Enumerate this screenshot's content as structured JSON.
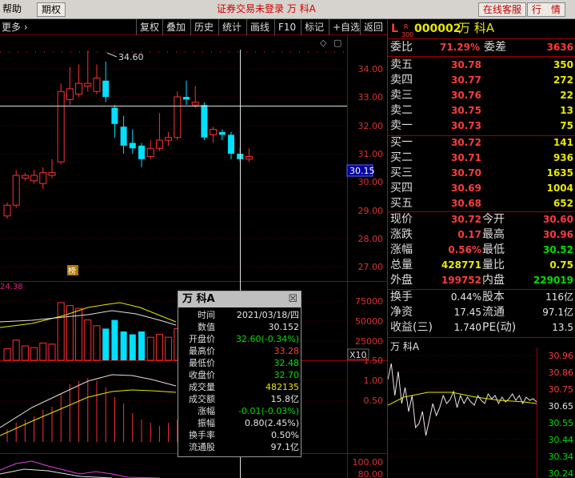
{
  "topbar": {
    "help": "帮助",
    "futures": "期权",
    "title": "证券交易未登录  万 科A",
    "service_btn": "在线客服",
    "quote_btn": "行　情"
  },
  "toolbar": {
    "more": "更多 ›",
    "items": [
      "复权",
      "叠加",
      "历史",
      "统计",
      "画线",
      "F10",
      "标记",
      "+自选",
      "返回"
    ]
  },
  "chart": {
    "price_axis": [
      "34.00",
      "33.00",
      "32.00",
      "31.00",
      "30.00",
      "29.00",
      "28.00",
      "27.00"
    ],
    "current_price_tag": "30.15",
    "high_marker": "34.60",
    "list_marker": "榜",
    "volume_label": "24.38",
    "volume_axis": [
      "75000",
      "50000",
      "25000"
    ],
    "volume_unit": "X10",
    "macd_axis": [
      "1.50",
      "1.00",
      "0.50"
    ],
    "kdj_axis": [
      "100.00",
      "80.00"
    ]
  },
  "chart_data": {
    "type": "candlestick",
    "ylim": [
      26.6,
      35.0
    ],
    "candles": [
      {
        "o": 28.5,
        "c": 28.9,
        "h": 29.0,
        "l": 28.4
      },
      {
        "o": 28.9,
        "c": 30.0,
        "h": 30.2,
        "l": 28.8
      },
      {
        "o": 29.9,
        "c": 30.0,
        "h": 30.1,
        "l": 29.8
      },
      {
        "o": 29.8,
        "c": 30.0,
        "h": 30.2,
        "l": 29.7
      },
      {
        "o": 29.7,
        "c": 30.1,
        "h": 30.3,
        "l": 29.5
      },
      {
        "o": 30.0,
        "c": 30.1,
        "h": 30.6,
        "l": 29.9
      },
      {
        "o": 30.5,
        "c": 33.1,
        "h": 33.4,
        "l": 30.4
      },
      {
        "o": 32.8,
        "c": 33.2,
        "h": 34.0,
        "l": 32.6
      },
      {
        "o": 33.0,
        "c": 33.4,
        "h": 34.1,
        "l": 32.9
      },
      {
        "o": 33.3,
        "c": 33.4,
        "h": 34.6,
        "l": 33.1
      },
      {
        "o": 33.1,
        "c": 33.6,
        "h": 34.1,
        "l": 33.0
      },
      {
        "o": 33.5,
        "c": 32.9,
        "h": 34.2,
        "l": 32.7
      },
      {
        "o": 32.5,
        "c": 31.9,
        "h": 32.6,
        "l": 31.4
      },
      {
        "o": 31.8,
        "c": 31.1,
        "h": 32.2,
        "l": 30.8
      },
      {
        "o": 31.2,
        "c": 31.0,
        "h": 31.7,
        "l": 30.8
      },
      {
        "o": 31.1,
        "c": 30.6,
        "h": 31.2,
        "l": 30.3
      },
      {
        "o": 30.7,
        "c": 31.0,
        "h": 31.3,
        "l": 30.6
      },
      {
        "o": 31.0,
        "c": 31.3,
        "h": 32.3,
        "l": 30.9
      },
      {
        "o": 31.3,
        "c": 31.4,
        "h": 31.6,
        "l": 31.1
      },
      {
        "o": 31.4,
        "c": 32.9,
        "h": 33.1,
        "l": 31.3
      },
      {
        "o": 32.9,
        "c": 32.8,
        "h": 33.5,
        "l": 32.6
      },
      {
        "o": 32.6,
        "c": 32.7,
        "h": 33.3,
        "l": 32.5
      },
      {
        "o": 32.6,
        "c": 31.4,
        "h": 32.7,
        "l": 31.3
      },
      {
        "o": 31.5,
        "c": 31.7,
        "h": 31.8,
        "l": 31.2
      },
      {
        "o": 31.6,
        "c": 31.5,
        "h": 31.7,
        "l": 31.3
      },
      {
        "o": 31.5,
        "c": 30.8,
        "h": 31.6,
        "l": 30.6
      },
      {
        "o": 30.8,
        "c": 30.6,
        "h": 31.0,
        "l": 30.5
      },
      {
        "o": 30.6,
        "c": 30.7,
        "h": 31.0,
        "l": 30.5
      }
    ]
  },
  "tooltip": {
    "name": "万 科A",
    "rows": [
      {
        "label": "时间",
        "value": "2021/03/18/四",
        "color": "#e6e6e6"
      },
      {
        "label": "数值",
        "value": "30.152",
        "color": "#e6e6e6"
      },
      {
        "label": "开盘价",
        "value": "32.60(-0.34%)",
        "color": "#00e000"
      },
      {
        "label": "最高价",
        "value": "33.28",
        "color": "#ff3b3b"
      },
      {
        "label": "最低价",
        "value": "32.48",
        "color": "#00e000"
      },
      {
        "label": "收盘价",
        "value": "32.70",
        "color": "#00e000"
      },
      {
        "label": "成交量",
        "value": "482135",
        "color": "#e8e800"
      },
      {
        "label": "成交额",
        "value": "15.8亿",
        "color": "#e6e6e6"
      },
      {
        "label": "涨幅",
        "value": "-0.01(-0.03%)",
        "color": "#00e000"
      },
      {
        "label": "振幅",
        "value": "0.80(2.45%)",
        "color": "#e6e6e6"
      },
      {
        "label": "换手率",
        "value": "0.50%",
        "color": "#e6e6e6"
      },
      {
        "label": "流通股",
        "value": "97.1亿",
        "color": "#e6e6e6"
      }
    ]
  },
  "panel": {
    "L": "L",
    "r_label": "R",
    "r_num": "300",
    "code": "000002",
    "name": "万 科A",
    "ratio_label": "委比",
    "ratio": "71.29%",
    "diff_label": "委差",
    "diff": "3636",
    "asks": [
      {
        "label": "卖五",
        "price": "30.78",
        "vol": "350"
      },
      {
        "label": "卖四",
        "price": "30.77",
        "vol": "272"
      },
      {
        "label": "卖三",
        "price": "30.76",
        "vol": "22"
      },
      {
        "label": "卖二",
        "price": "30.75",
        "vol": "13"
      },
      {
        "label": "卖一",
        "price": "30.73",
        "vol": "75"
      }
    ],
    "bids": [
      {
        "label": "买一",
        "price": "30.72",
        "vol": "141"
      },
      {
        "label": "买二",
        "price": "30.71",
        "vol": "936"
      },
      {
        "label": "买三",
        "price": "30.70",
        "vol": "1635"
      },
      {
        "label": "买四",
        "price": "30.69",
        "vol": "1004"
      },
      {
        "label": "买五",
        "price": "30.68",
        "vol": "652"
      }
    ],
    "stats": [
      {
        "l1": "现价",
        "v1": "30.72",
        "c1": "#ff3b3b",
        "l2": "今开",
        "v2": "30.60",
        "c2": "#ff3b3b"
      },
      {
        "l1": "涨跌",
        "v1": "0.17",
        "c1": "#ff3b3b",
        "l2": "最高",
        "v2": "30.96",
        "c2": "#ff3b3b"
      },
      {
        "l1": "涨幅",
        "v1": "0.56%",
        "c1": "#ff3b3b",
        "l2": "最低",
        "v2": "30.52",
        "c2": "#00e000"
      },
      {
        "l1": "总量",
        "v1": "428771",
        "c1": "#e8e800",
        "l2": "量比",
        "v2": "0.75",
        "c2": "#e8e800"
      },
      {
        "l1": "外盘",
        "v1": "199752",
        "c1": "#ff3b3b",
        "l2": "内盘",
        "v2": "229019",
        "c2": "#00e000"
      }
    ],
    "info": [
      {
        "l1": "换手",
        "v1": "0.44%",
        "l2": "股本",
        "v2": "116亿"
      },
      {
        "l1": "净资",
        "v1": "17.45",
        "l2": "流通",
        "v2": "97.1亿"
      },
      {
        "l1": "收益(三)",
        "v1": "1.740",
        "l2": "PE(动)",
        "v2": "13.5"
      }
    ],
    "mini_title": "万 科A",
    "mini_axis": [
      "30.96",
      "30.86",
      "30.75",
      "30.65",
      "30.55",
      "30.44",
      "30.34",
      "30.24"
    ]
  }
}
